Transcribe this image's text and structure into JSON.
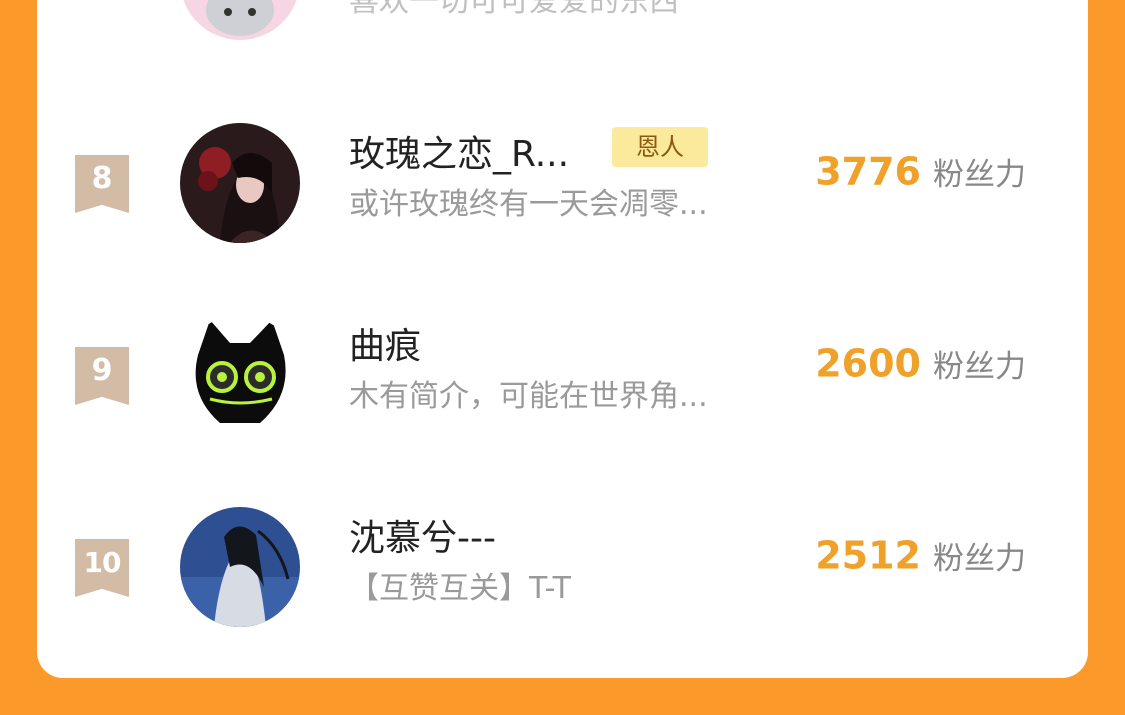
{
  "previous_row": {
    "bio": "喜欢一切可可爱爱的东西"
  },
  "score_unit": "粉丝力",
  "rows": [
    {
      "rank": "8",
      "name": "玫瑰之恋_R...",
      "badge": "恩人",
      "bio": "或许玫瑰终有一天会凋零...",
      "score": "3776"
    },
    {
      "rank": "9",
      "name": "曲痕",
      "bio": "木有简介，可能在世界角...",
      "score": "2600"
    },
    {
      "rank": "10",
      "name": "沈慕兮---",
      "bio": "【互赞互关】T-T",
      "score": "2512"
    }
  ],
  "colors": {
    "background": "#FB9A2A",
    "score": "#F0A12A",
    "rank_badge": "#D2BCA6",
    "title_badge": "#FCEA9C"
  }
}
